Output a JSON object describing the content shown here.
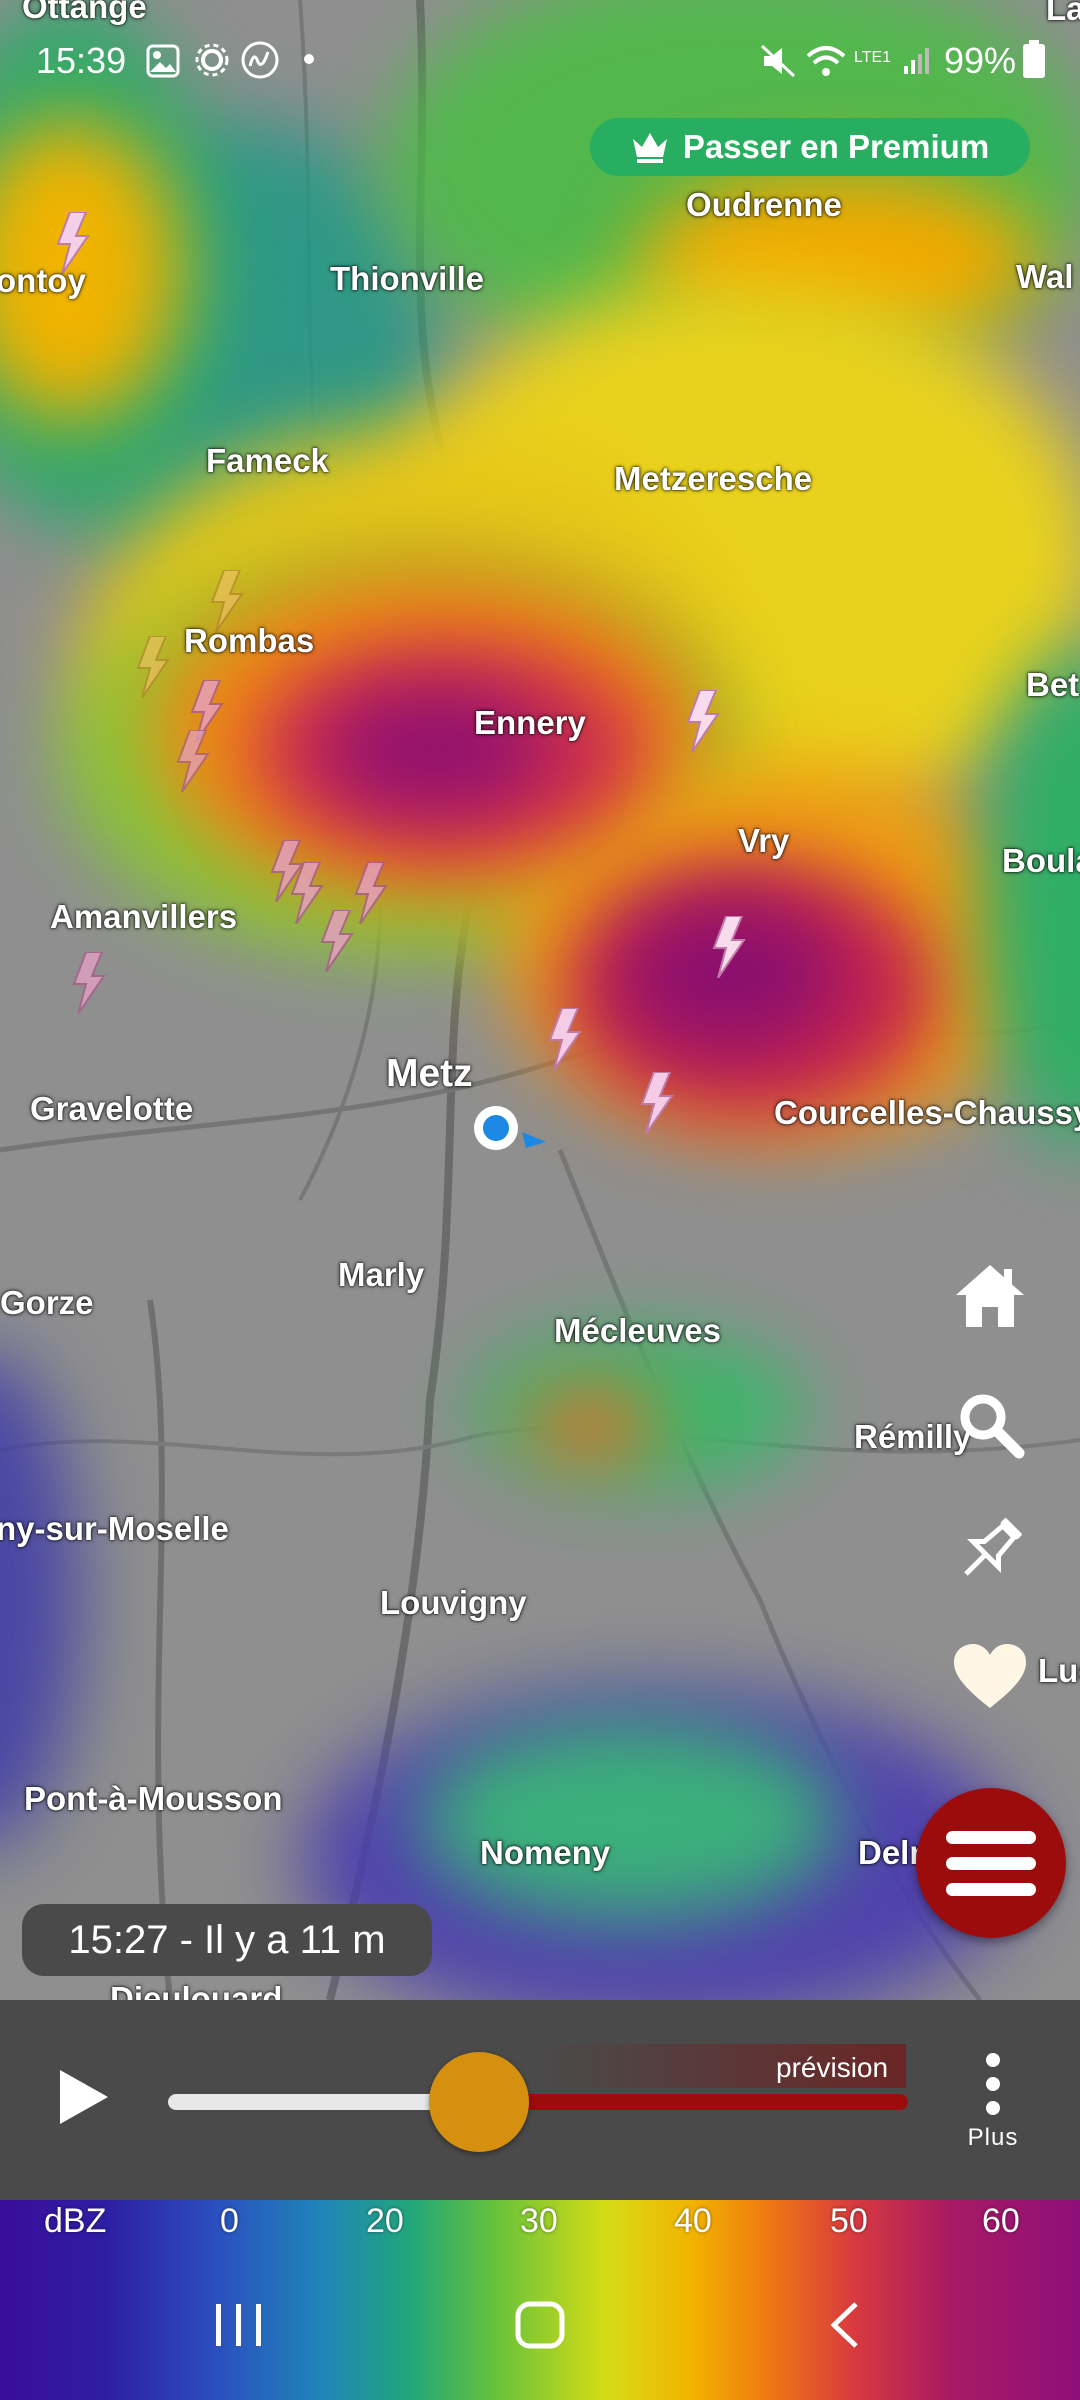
{
  "status_bar": {
    "time": "15:39",
    "battery": "99%",
    "network": "LTE1"
  },
  "premium_button": {
    "label": "Passer en Premium"
  },
  "map": {
    "cities": [
      "Oudrenne",
      "Thionville",
      "Fameck",
      "Metzeresche",
      "Rombas",
      "Ennery",
      "Vry",
      "Amanvillers",
      "Metz",
      "Gravelotte",
      "Courcelles-Chaussy",
      "Marly",
      "Mécleuves",
      "Gorze",
      "Rémilly",
      "ny-sur-Moselle",
      "Louvigny",
      "Pont-à-Mousson",
      "Nomeny",
      "Dieulouard",
      "ontoy",
      "Wal",
      "Bet",
      "Boula",
      "Luc",
      "Deln",
      "La",
      "Ottange"
    ]
  },
  "timestamp": {
    "label": "15:27 - Il y a 11 m"
  },
  "player": {
    "forecast_label": "prévision",
    "more_label": "Plus",
    "progress": 0.42
  },
  "legend": {
    "unit": "dBZ",
    "ticks": [
      "0",
      "20",
      "30",
      "40",
      "50",
      "60"
    ]
  },
  "icons": {
    "home": "home-icon",
    "search": "search-icon",
    "pin": "pin-icon",
    "favorite": "heart-icon",
    "menu": "menu-icon",
    "play": "play-icon"
  }
}
